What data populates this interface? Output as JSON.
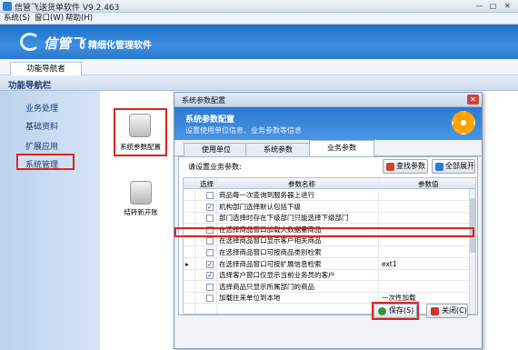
{
  "window": {
    "title": "信管飞送货单软件 V9.2.463"
  },
  "menu": [
    "系统(S)",
    "窗口(W)",
    "帮助(H)"
  ],
  "banner": {
    "logo": "信管飞",
    "slogan": "精细化管理软件"
  },
  "main_tab": "功能导航者",
  "nav": {
    "header": "功能导航栏",
    "items": [
      "业务处理",
      "基础资料",
      "扩展应用",
      "系统管理"
    ]
  },
  "functions": [
    {
      "label": "系统参数配置"
    },
    {
      "label": "结转新开账"
    }
  ],
  "dialog": {
    "title": "系统参数配置",
    "header_title": "系统参数配置",
    "header_sub": "设置使用单位信息、业务参数等信息",
    "tabs": [
      "使用单位",
      "系统参数",
      "业务参数"
    ],
    "choose_label": "请设置业务参数:",
    "find_btn": "查找参数",
    "expand_btn": "全部展开",
    "columns": {
      "select": "选择",
      "name": "参数名称",
      "value": "参数值"
    },
    "rows": [
      {
        "checked": false,
        "name": "商品每一次查询到服务器上进行",
        "value": ""
      },
      {
        "checked": true,
        "name": "机构部门选择默认包括下级",
        "value": ""
      },
      {
        "checked": false,
        "name": "部门选择时存在下级部门只能选择下级部门",
        "value": ""
      },
      {
        "checked": false,
        "name": "在选择商品窗口加载大数据量商品",
        "value": ""
      },
      {
        "checked": false,
        "name": "在选择商品窗口显示客户相关商品",
        "value": ""
      },
      {
        "checked": false,
        "name": "在选择商品窗口可按商品类别检索",
        "value": ""
      },
      {
        "checked": true,
        "name": "在选择商品窗口可按扩展信息检索",
        "value": "ext1"
      },
      {
        "checked": true,
        "name": "选择客户窗口仅显示当前业务员的客户",
        "value": ""
      },
      {
        "checked": false,
        "name": "选择商品只显示所属部门的商品",
        "value": ""
      },
      {
        "checked": false,
        "name": "加载往来单位到本地",
        "value": "一次性加载"
      }
    ],
    "save_btn": "保存(S)",
    "close_btn": "关闭(C)"
  }
}
